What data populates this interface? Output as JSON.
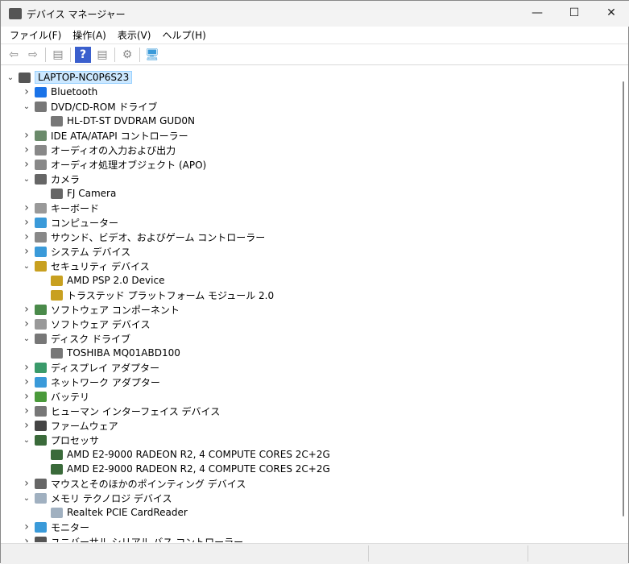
{
  "window": {
    "title": "デバイス マネージャー",
    "minimize": "—",
    "maximize": "☐",
    "close": "✕"
  },
  "menu": [
    "ファイル(F)",
    "操作(A)",
    "表示(V)",
    "ヘルプ(H)"
  ],
  "toolbar": [
    {
      "icon": "back-arrow-icon",
      "glyph": "⇦"
    },
    {
      "icon": "forward-arrow-icon",
      "glyph": "⇨"
    },
    {
      "sep": true
    },
    {
      "icon": "show-hide-console-tree-icon",
      "glyph": "▤"
    },
    {
      "sep": true
    },
    {
      "icon": "help-icon",
      "glyph": "?"
    },
    {
      "icon": "properties-pane-icon",
      "glyph": "▤"
    },
    {
      "sep": true
    },
    {
      "icon": "scan-hardware-icon",
      "glyph": "⚙"
    },
    {
      "sep": true
    },
    {
      "icon": "monitor-icon",
      "glyph": "🖥"
    }
  ],
  "tree": [
    {
      "level": 0,
      "state": "expanded",
      "label": "LAPTOP-NC0P6S23",
      "icon": "computer-icon",
      "color": "#555555"
    },
    {
      "level": 1,
      "state": "collapsed",
      "label": "Bluetooth",
      "icon": "bluetooth-icon",
      "color": "#1a73e8"
    },
    {
      "level": 1,
      "state": "expanded",
      "label": "DVD/CD-ROM ドライブ",
      "icon": "dvd-drive-icon",
      "color": "#777777"
    },
    {
      "level": 2,
      "state": "leaf",
      "label": "HL-DT-ST DVDRAM GUD0N",
      "icon": "dvd-drive-icon",
      "color": "#777777"
    },
    {
      "level": 1,
      "state": "collapsed",
      "label": "IDE ATA/ATAPI コントローラー",
      "icon": "ide-controller-icon",
      "color": "#6a8a6a"
    },
    {
      "level": 1,
      "state": "collapsed",
      "label": "オーディオの入力および出力",
      "icon": "speaker-icon",
      "color": "#888888"
    },
    {
      "level": 1,
      "state": "collapsed",
      "label": "オーディオ処理オブジェクト (APO)",
      "icon": "speaker-icon",
      "color": "#888888"
    },
    {
      "level": 1,
      "state": "expanded",
      "label": "カメラ",
      "icon": "camera-icon",
      "color": "#666666"
    },
    {
      "level": 2,
      "state": "leaf",
      "label": "FJ Camera",
      "icon": "camera-icon",
      "color": "#666666"
    },
    {
      "level": 1,
      "state": "collapsed",
      "label": "キーボード",
      "icon": "keyboard-icon",
      "color": "#999999"
    },
    {
      "level": 1,
      "state": "collapsed",
      "label": "コンピューター",
      "icon": "monitor-icon",
      "color": "#3a9ad9"
    },
    {
      "level": 1,
      "state": "collapsed",
      "label": "サウンド、ビデオ、およびゲーム コントローラー",
      "icon": "speaker-icon",
      "color": "#888888"
    },
    {
      "level": 1,
      "state": "collapsed",
      "label": "システム デバイス",
      "icon": "system-device-icon",
      "color": "#3a9ad9"
    },
    {
      "level": 1,
      "state": "expanded",
      "label": "セキュリティ デバイス",
      "icon": "security-key-icon",
      "color": "#c8a020"
    },
    {
      "level": 2,
      "state": "leaf",
      "label": "AMD PSP 2.0 Device",
      "icon": "security-key-icon",
      "color": "#c8a020"
    },
    {
      "level": 2,
      "state": "leaf",
      "label": "トラステッド プラットフォーム モジュール 2.0",
      "icon": "security-key-icon",
      "color": "#c8a020"
    },
    {
      "level": 1,
      "state": "collapsed",
      "label": "ソフトウェア コンポーネント",
      "icon": "software-component-icon",
      "color": "#4a8a4a"
    },
    {
      "level": 1,
      "state": "collapsed",
      "label": "ソフトウェア デバイス",
      "icon": "software-device-icon",
      "color": "#999999"
    },
    {
      "level": 1,
      "state": "expanded",
      "label": "ディスク ドライブ",
      "icon": "disk-drive-icon",
      "color": "#777777"
    },
    {
      "level": 2,
      "state": "leaf",
      "label": "TOSHIBA MQ01ABD100",
      "icon": "disk-drive-icon",
      "color": "#777777"
    },
    {
      "level": 1,
      "state": "collapsed",
      "label": "ディスプレイ アダプター",
      "icon": "display-adapter-icon",
      "color": "#3a9a6a"
    },
    {
      "level": 1,
      "state": "collapsed",
      "label": "ネットワーク アダプター",
      "icon": "network-adapter-icon",
      "color": "#3a9ad9"
    },
    {
      "level": 1,
      "state": "collapsed",
      "label": "バッテリ",
      "icon": "battery-icon",
      "color": "#4a9a3a"
    },
    {
      "level": 1,
      "state": "collapsed",
      "label": "ヒューマン インターフェイス デバイス",
      "icon": "hid-icon",
      "color": "#777777"
    },
    {
      "level": 1,
      "state": "collapsed",
      "label": "ファームウェア",
      "icon": "firmware-icon",
      "color": "#444444"
    },
    {
      "level": 1,
      "state": "expanded",
      "label": "プロセッサ",
      "icon": "processor-icon",
      "color": "#3a6a3a"
    },
    {
      "level": 2,
      "state": "leaf",
      "label": "AMD E2-9000 RADEON R2, 4 COMPUTE CORES 2C+2G",
      "icon": "processor-icon",
      "color": "#3a6a3a"
    },
    {
      "level": 2,
      "state": "leaf",
      "label": "AMD E2-9000 RADEON R2, 4 COMPUTE CORES 2C+2G",
      "icon": "processor-icon",
      "color": "#3a6a3a"
    },
    {
      "level": 1,
      "state": "collapsed",
      "label": "マウスとそのほかのポインティング デバイス",
      "icon": "mouse-icon",
      "color": "#666666"
    },
    {
      "level": 1,
      "state": "expanded",
      "label": "メモリ テクノロジ デバイス",
      "icon": "memory-card-icon",
      "color": "#a0b0c0"
    },
    {
      "level": 2,
      "state": "leaf",
      "label": "Realtek PCIE CardReader",
      "icon": "memory-card-icon",
      "color": "#a0b0c0"
    },
    {
      "level": 1,
      "state": "collapsed",
      "label": "モニター",
      "icon": "monitor-icon",
      "color": "#3a9ad9"
    },
    {
      "level": 1,
      "state": "collapsed",
      "label": "ユニバーサル シリアル バス コントローラー",
      "icon": "usb-icon",
      "color": "#555555"
    }
  ]
}
